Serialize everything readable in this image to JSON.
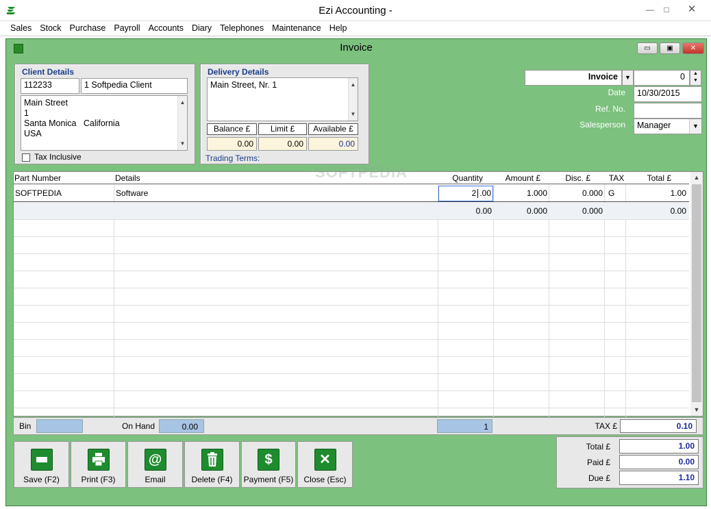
{
  "window": {
    "title": "Ezi Accounting -",
    "minimize": "—",
    "maximize": "□",
    "close": "✕"
  },
  "menu": [
    "Sales",
    "Stock",
    "Purchase",
    "Payroll",
    "Accounts",
    "Diary",
    "Telephones",
    "Maintenance",
    "Help"
  ],
  "child": {
    "title": "Invoice",
    "minimize": "▭",
    "restore": "▣",
    "close": "✕"
  },
  "client": {
    "label": "Client Details",
    "code": "112233",
    "name": "1 Softpedia Client",
    "address": [
      "Main Street",
      "1",
      "Santa Monica   California",
      "USA"
    ],
    "tax_inclusive_label": "Tax Inclusive"
  },
  "delivery": {
    "label": "Delivery Details",
    "address": "Main Street, Nr. 1",
    "balance_label": "Balance £",
    "limit_label": "Limit £",
    "available_label": "Available £",
    "balance": "0.00",
    "limit": "0.00",
    "available": "0.00",
    "trading_terms_label": "Trading Terms:"
  },
  "invoice": {
    "type": "Invoice",
    "number": "0",
    "date_label": "Date",
    "date": "10/30/2015",
    "ref_label": "Ref. No.",
    "ref": "",
    "salesperson_label": "Salesperson",
    "salesperson": "Manager"
  },
  "grid": {
    "headers": [
      "Part Number",
      "Details",
      "Quantity",
      "Amount £",
      "Disc. £",
      "TAX",
      "Total £"
    ],
    "rows": [
      {
        "part": "SOFTPEDIA",
        "details": "Software",
        "qty_int": "2",
        "qty_dec": ".00",
        "amount": "1.000",
        "disc": "0.000",
        "tax": "G",
        "total": "1.00"
      },
      {
        "part": "",
        "details": "",
        "qty": "0.00",
        "amount": "0.000",
        "disc": "0.000",
        "tax": "",
        "total": "0.00"
      }
    ]
  },
  "footer": {
    "bin_label": "Bin",
    "bin": "",
    "onhand_label": "On Hand",
    "onhand": "0.00",
    "count": "1",
    "tax_label": "TAX £",
    "tax": "0.10"
  },
  "buttons": [
    {
      "label": "Save (F2)",
      "icon": "save-icon"
    },
    {
      "label": "Print (F3)",
      "icon": "printer-icon"
    },
    {
      "label": "Email",
      "icon": "at-sign-icon"
    },
    {
      "label": "Delete (F4)",
      "icon": "trash-icon"
    },
    {
      "label": "Payment (F5)",
      "icon": "dollar-icon"
    },
    {
      "label": "Close (Esc)",
      "icon": "close-x-icon"
    }
  ],
  "totals": {
    "total_label": "Total £",
    "total": "1.00",
    "paid_label": "Paid £",
    "paid": "0.00",
    "due_label": "Due £",
    "due": "1.10"
  },
  "watermark": "SOFTPEDIA"
}
